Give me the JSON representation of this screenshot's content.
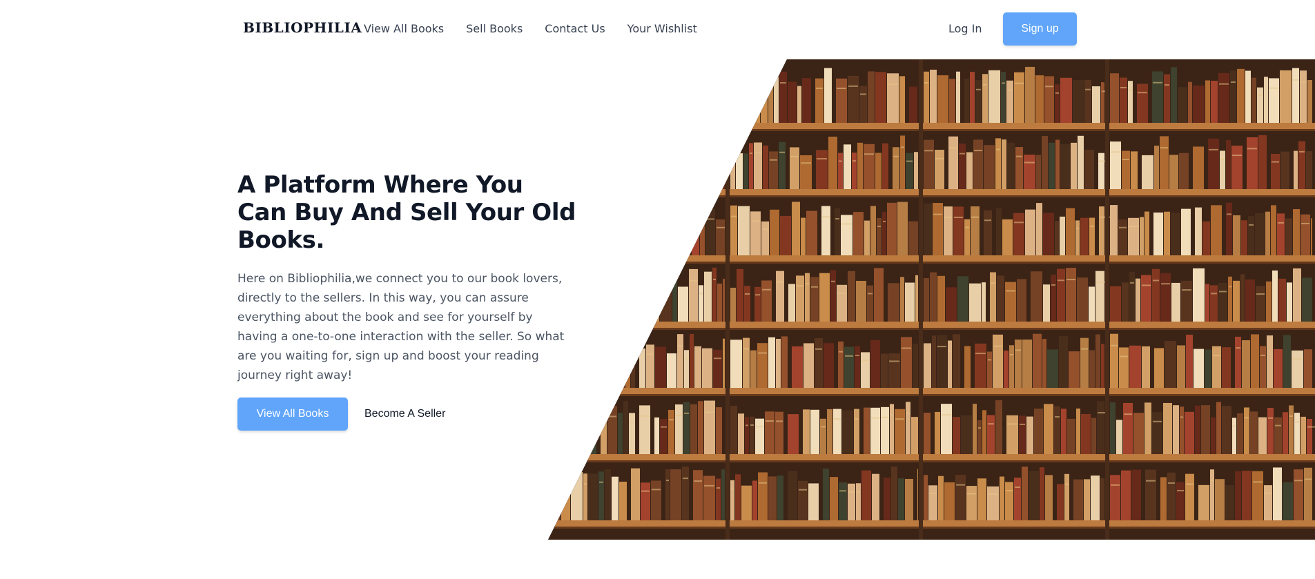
{
  "nav": {
    "brand": "BIBLIOPHILIA",
    "links": [
      "View All Books",
      "Sell Books",
      "Contact Us",
      "Your Wishlist"
    ],
    "login_label": "Log In",
    "signup_label": "Sign up"
  },
  "hero": {
    "title": "A Platform Where You Can Buy And Sell Your Old Books.",
    "description": "Here on Bibliophilia,we connect you to our book lovers, directly to the sellers. In this way, you can assure everything about the book and see for yourself by having a one-to-one interaction with the seller. So what are you waiting for, sign up and boost your reading journey right away!",
    "primary_cta": "View All Books",
    "secondary_cta": "Become A Seller"
  },
  "colors": {
    "accent": "#60a5fa",
    "heading": "#111827",
    "body_text": "#4b5563",
    "nav_text": "#374151"
  }
}
